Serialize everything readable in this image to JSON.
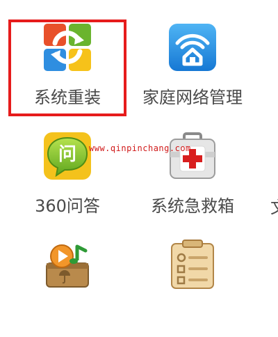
{
  "tiles": [
    {
      "label": "系统重装",
      "icon": "system-reinstall-icon",
      "selected": true
    },
    {
      "label": "家庭网络管理",
      "icon": "home-network-icon"
    },
    {
      "label": "360问答",
      "icon": "qa-chat-icon"
    },
    {
      "label": "系统急救箱",
      "icon": "first-aid-kit-icon"
    },
    {
      "label": "",
      "icon": "media-box-icon"
    },
    {
      "label": "",
      "icon": "notepad-settings-icon"
    }
  ],
  "watermark": "www.qinpinchang.com",
  "edge_glyph": "文",
  "colors": {
    "selection_border": "#e61c1c",
    "label_text": "#4a4a4a",
    "watermark_text": "#d01818"
  }
}
